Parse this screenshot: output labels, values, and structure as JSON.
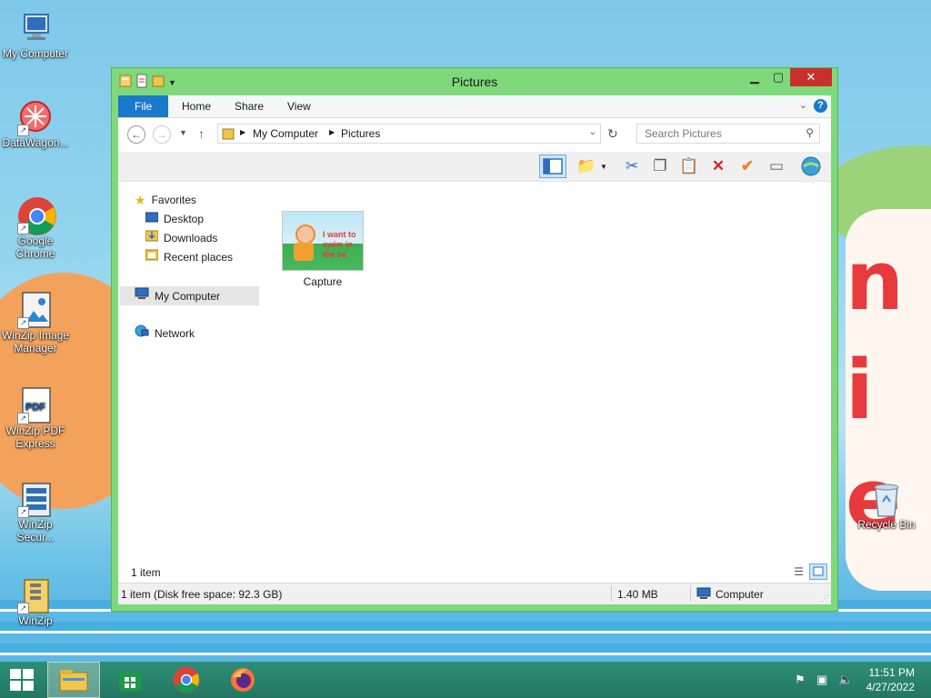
{
  "desktop_icons": [
    {
      "label": "My Computer",
      "icon": "computer-icon"
    },
    {
      "label": "DataWagon...",
      "icon": "datawagon-icon"
    },
    {
      "label": "Google Chrome",
      "icon": "chrome-icon"
    },
    {
      "label": "WinZip Image Manager",
      "icon": "winzip-image-icon"
    },
    {
      "label": "WinZip PDF Express",
      "icon": "pdf-icon"
    },
    {
      "label": "WinZip Secur...",
      "icon": "winzip-secure-icon"
    },
    {
      "label": "WinZip",
      "icon": "winzip-icon"
    },
    {
      "label": "Recycle Bin",
      "icon": "recycle-bin-icon"
    }
  ],
  "window": {
    "title": "Pictures",
    "tabs": {
      "file": "File",
      "home": "Home",
      "share": "Share",
      "view": "View"
    },
    "breadcrumb": [
      "My Computer",
      "Pictures"
    ],
    "search_placeholder": "Search Pictures",
    "nav": {
      "favorites": "Favorites",
      "desktop": "Desktop",
      "downloads": "Downloads",
      "recent": "Recent places",
      "my_computer": "My Computer",
      "network": "Network"
    },
    "files": [
      {
        "name": "Capture",
        "thumb_text": "I want to swim in the se"
      }
    ],
    "item_count": "1 item",
    "status": {
      "details": "1 item (Disk free space: 92.3 GB)",
      "size": "1.40 MB",
      "location": "Computer"
    }
  },
  "taskbar": {
    "time": "11:51 PM",
    "date": "4/27/2022"
  },
  "colors": {
    "window_frame": "#7fd97a",
    "taskbar": "#2a8a72",
    "file_tab": "#1979ca",
    "close": "#c9302c"
  }
}
